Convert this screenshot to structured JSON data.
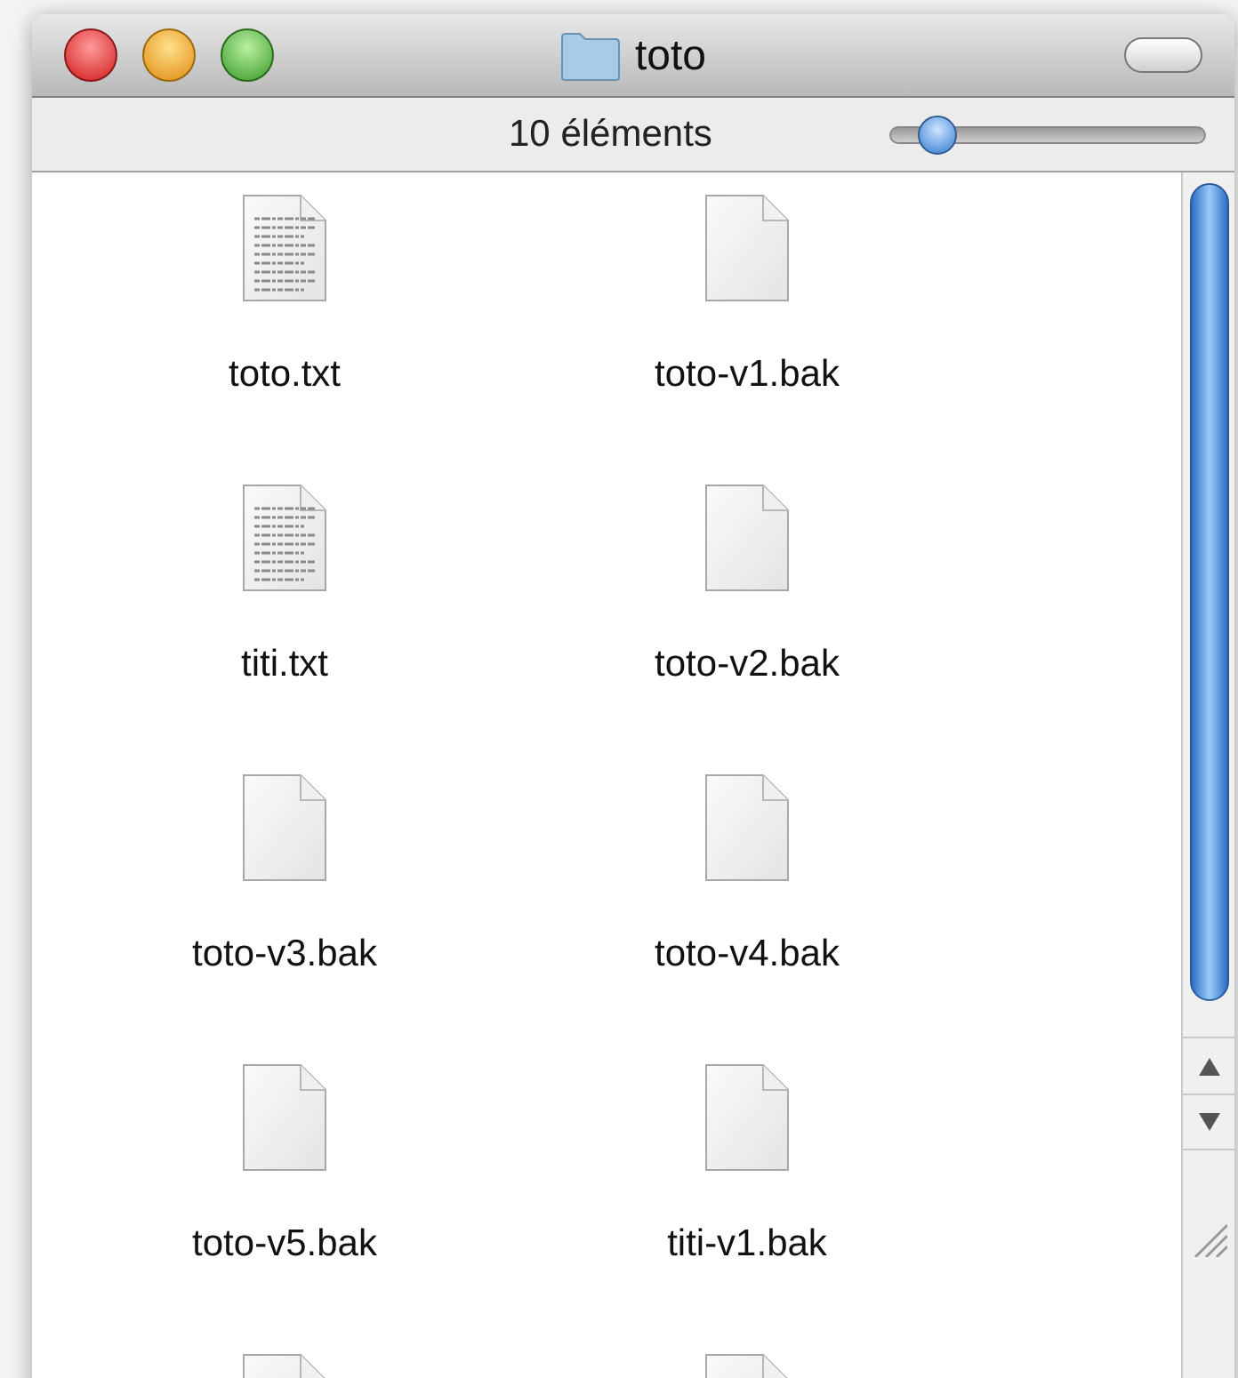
{
  "window": {
    "title": "toto"
  },
  "status_bar": {
    "text": "10 éléments",
    "slider": {
      "level": 0.1
    }
  },
  "items": [
    {
      "kind": "text",
      "name": "toto.txt"
    },
    {
      "kind": "blank",
      "name": "toto-v1.bak"
    },
    {
      "kind": "text",
      "name": "titi.txt"
    },
    {
      "kind": "blank",
      "name": "toto-v2.bak"
    },
    {
      "kind": "blank",
      "name": "toto-v3.bak"
    },
    {
      "kind": "blank",
      "name": "toto-v4.bak"
    },
    {
      "kind": "blank",
      "name": "toto-v5.bak"
    },
    {
      "kind": "blank",
      "name": "titi-v1.bak"
    },
    {
      "kind": "blank"
    },
    {
      "kind": "blank"
    }
  ]
}
